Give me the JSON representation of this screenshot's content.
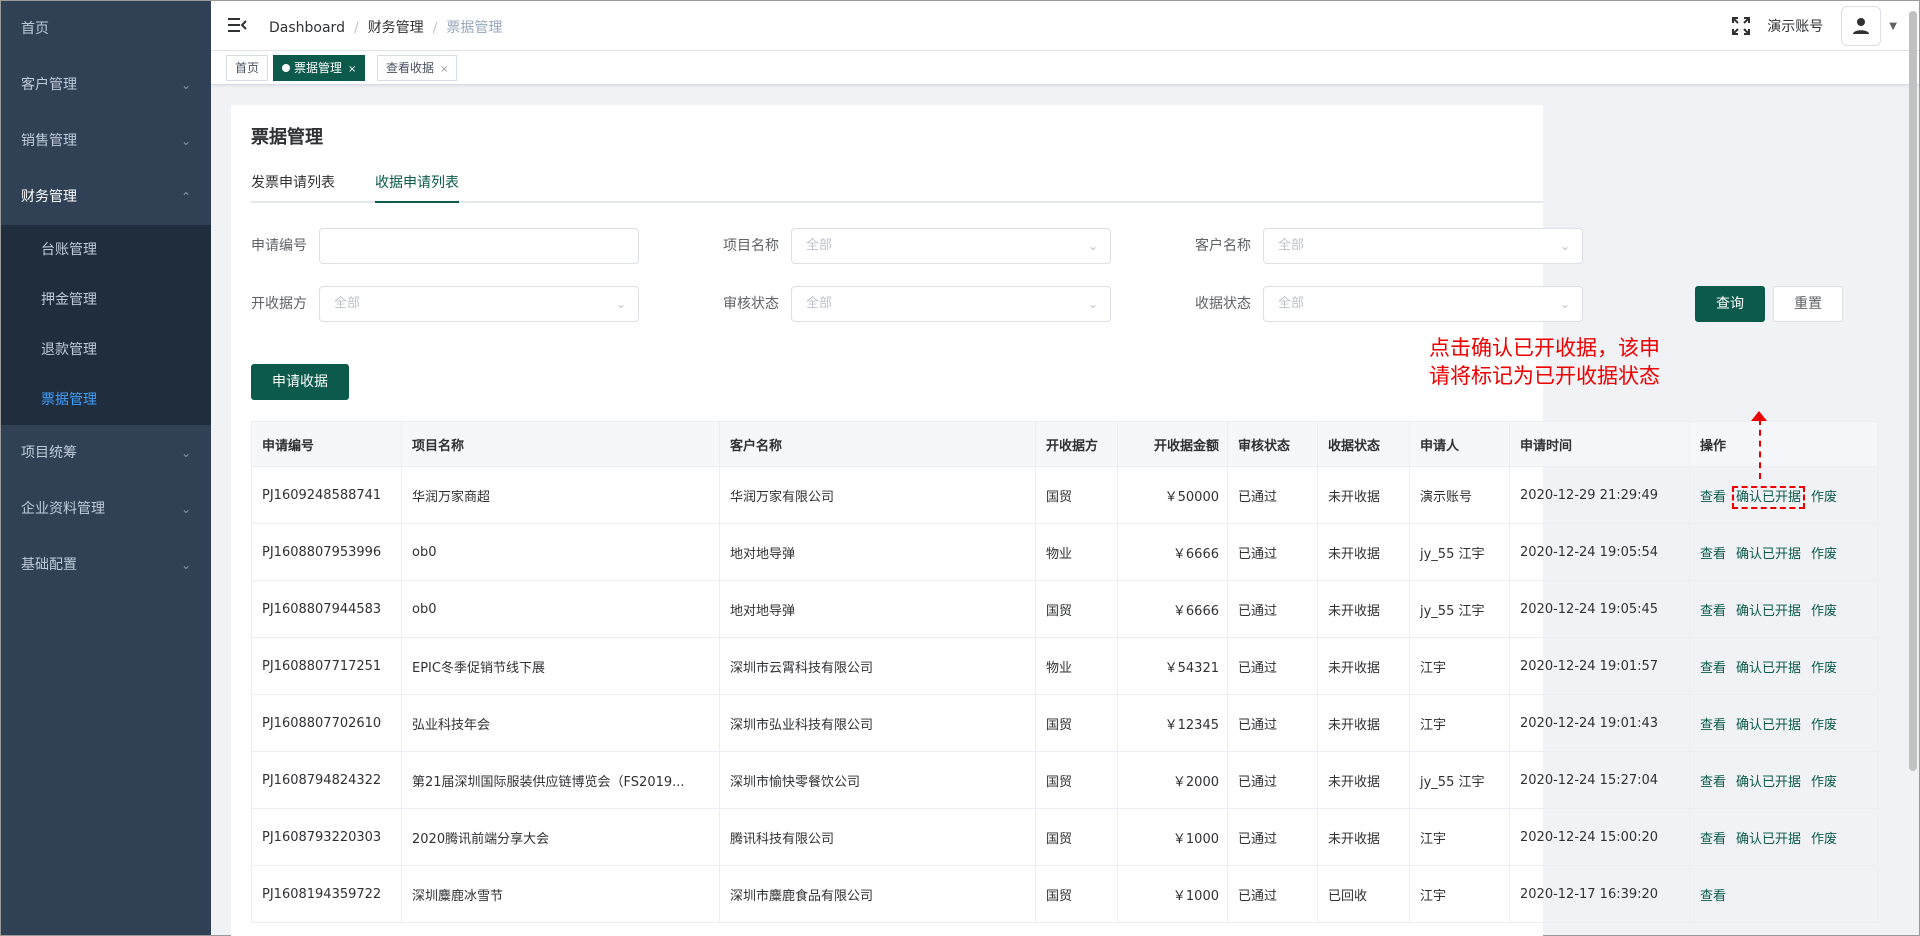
{
  "sidebar": {
    "items": [
      {
        "label": "首页",
        "chevron": false
      },
      {
        "label": "客户管理",
        "chevron": true
      },
      {
        "label": "销售管理",
        "chevron": true
      },
      {
        "label": "财务管理",
        "chevron": true,
        "expanded": true
      },
      {
        "label": "项目统筹",
        "chevron": true
      },
      {
        "label": "企业资料管理",
        "chevron": true
      },
      {
        "label": "基础配置",
        "chevron": true
      }
    ],
    "sub_items": [
      "台账管理",
      "押金管理",
      "退款管理",
      "票据管理"
    ],
    "active_sub": "票据管理"
  },
  "header": {
    "breadcrumb": [
      "Dashboard",
      "财务管理",
      "票据管理"
    ],
    "account": "演示账号"
  },
  "tags": [
    {
      "label": "首页"
    },
    {
      "label": "票据管理",
      "active": true,
      "close": "×"
    },
    {
      "label": "查看收据",
      "close": "×"
    }
  ],
  "page": {
    "title": "票据管理",
    "tabs": [
      "发票申请列表",
      "收据申请列表"
    ],
    "active_tab": "收据申请列表"
  },
  "filters": {
    "apply_no_label": "申请编号",
    "project_label": "项目名称",
    "project_placeholder": "全部",
    "customer_label": "客户名称",
    "customer_placeholder": "全部",
    "issuer_label": "开收据方",
    "issuer_placeholder": "全部",
    "audit_label": "审核状态",
    "audit_placeholder": "全部",
    "receipt_label": "收据状态",
    "receipt_placeholder": "全部",
    "query_btn": "查询",
    "reset_btn": "重置",
    "apply_btn": "申请收据"
  },
  "annotation": "点击确认已开收据，该申请将标记为已开收据状态",
  "colors": {
    "primary": "#0b5a4b",
    "sidebar": "#304156",
    "annotation": "#e00000"
  },
  "table": {
    "headers": [
      "申请编号",
      "项目名称",
      "客户名称",
      "开收据方",
      "开收据金额",
      "审核状态",
      "收据状态",
      "申请人",
      "申请时间",
      "操作"
    ],
    "op_view": "查看",
    "op_confirm": "确认已开据",
    "op_void": "作废",
    "rows": [
      {
        "no": "PJ1609248588741",
        "project": "华润万家商超",
        "customer": "华润万家有限公司",
        "issuer": "国贸",
        "amount": "￥50000",
        "audit": "已通过",
        "status": "未开收据",
        "applicant": "演示账号",
        "time": "2020-12-29 21:29:49",
        "ops": 3
      },
      {
        "no": "PJ1608807953996",
        "project": "ob0",
        "customer": "地对地导弹",
        "issuer": "物业",
        "amount": "￥6666",
        "audit": "已通过",
        "status": "未开收据",
        "applicant": "jy_55 江宇",
        "time": "2020-12-24 19:05:54",
        "ops": 3
      },
      {
        "no": "PJ1608807944583",
        "project": "ob0",
        "customer": "地对地导弹",
        "issuer": "国贸",
        "amount": "￥6666",
        "audit": "已通过",
        "status": "未开收据",
        "applicant": "jy_55 江宇",
        "time": "2020-12-24 19:05:45",
        "ops": 3
      },
      {
        "no": "PJ1608807717251",
        "project": "EPIC冬季促销节线下展",
        "customer": "深圳市云霄科技有限公司",
        "issuer": "物业",
        "amount": "￥54321",
        "audit": "已通过",
        "status": "未开收据",
        "applicant": "江宇",
        "time": "2020-12-24 19:01:57",
        "ops": 3
      },
      {
        "no": "PJ1608807702610",
        "project": "弘业科技年会",
        "customer": "深圳市弘业科技有限公司",
        "issuer": "国贸",
        "amount": "￥12345",
        "audit": "已通过",
        "status": "未开收据",
        "applicant": "江宇",
        "time": "2020-12-24 19:01:43",
        "ops": 3
      },
      {
        "no": "PJ1608794824322",
        "project": "第21届深圳国际服装供应链博览会（FS2019...",
        "customer": "深圳市愉快零餐饮公司",
        "issuer": "国贸",
        "amount": "￥2000",
        "audit": "已通过",
        "status": "未开收据",
        "applicant": "jy_55 江宇",
        "time": "2020-12-24 15:27:04",
        "ops": 3
      },
      {
        "no": "PJ1608793220303",
        "project": "2020腾讯前端分享大会",
        "customer": "腾讯科技有限公司",
        "issuer": "国贸",
        "amount": "￥1000",
        "audit": "已通过",
        "status": "未开收据",
        "applicant": "江宇",
        "time": "2020-12-24 15:00:20",
        "ops": 3
      },
      {
        "no": "PJ1608194359722",
        "project": "深圳麋鹿冰雪节",
        "customer": "深圳市麋鹿食品有限公司",
        "issuer": "国贸",
        "amount": "￥1000",
        "audit": "已通过",
        "status": "已回收",
        "applicant": "江宇",
        "time": "2020-12-17 16:39:20",
        "ops": 1
      }
    ]
  }
}
